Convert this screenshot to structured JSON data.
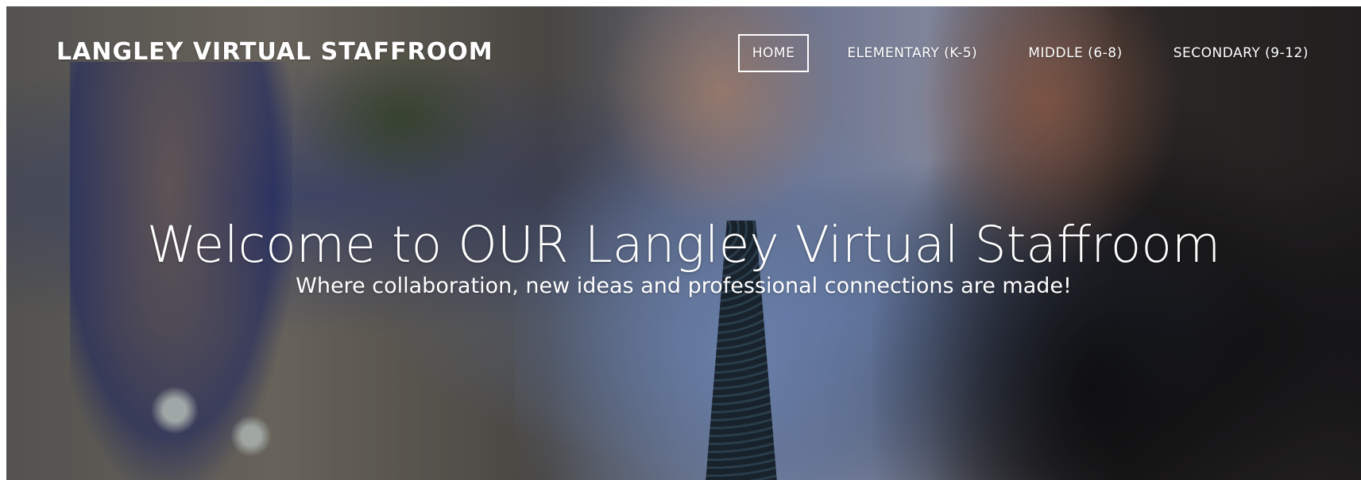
{
  "site": {
    "title": "LANGLEY VIRTUAL STAFFROOM"
  },
  "nav": {
    "items": [
      {
        "label": "HOME",
        "active": true
      },
      {
        "label": "ELEMENTARY (K-5)",
        "active": false
      },
      {
        "label": "MIDDLE (6-8)",
        "active": false
      },
      {
        "label": "SECONDARY (9-12)",
        "active": false
      }
    ]
  },
  "hero": {
    "heading": "Welcome to OUR Langley Virtual Staffroom",
    "subheading": "Where collaboration, new ideas and professional connections are made!"
  },
  "colors": {
    "text": "#ffffff",
    "nav_active_border": "#ffffff"
  }
}
